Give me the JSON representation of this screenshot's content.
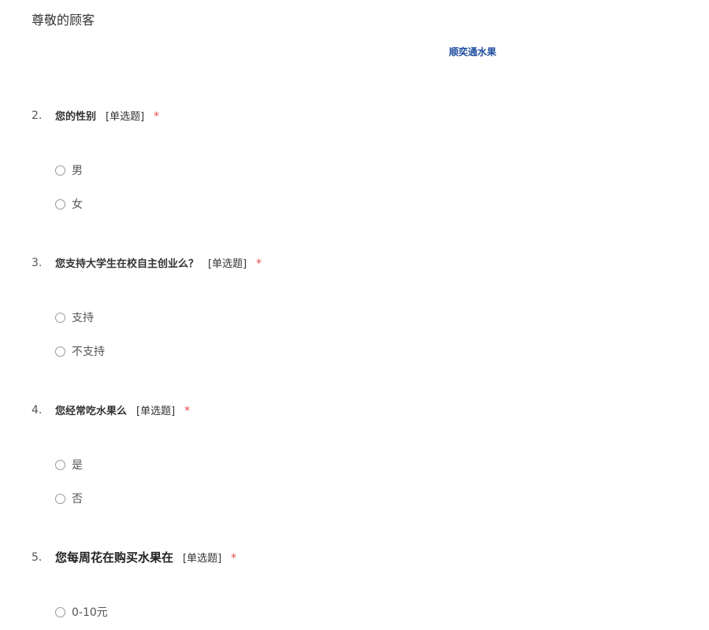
{
  "header": {
    "greeting": "尊敬的顾客",
    "brand": "顺奕通水果"
  },
  "questions": [
    {
      "number": "2.",
      "title": "您的性别",
      "type_label": "[单选题]",
      "required_mark": "*",
      "options": [
        "男",
        "女"
      ]
    },
    {
      "number": "3.",
      "title": "您支持大学生在校自主创业么？",
      "type_label": "[单选题]",
      "required_mark": "*",
      "options": [
        "支持",
        "不支持"
      ]
    },
    {
      "number": "4.",
      "title": "您经常吃水果么",
      "type_label": "[单选题]",
      "required_mark": "*",
      "options": [
        "是",
        "否"
      ]
    },
    {
      "number": "5.",
      "title": "您每周花在购买水果在",
      "type_label": "[单选题]",
      "required_mark": "*",
      "options": [
        "0-10元"
      ]
    }
  ]
}
